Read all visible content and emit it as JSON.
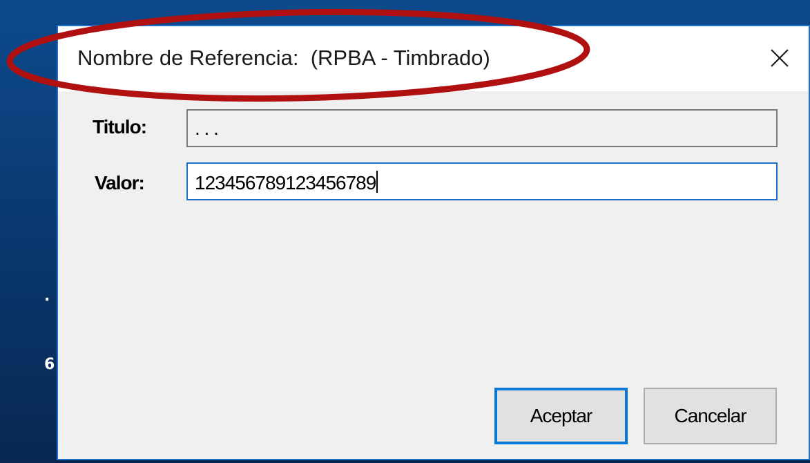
{
  "background": {
    "fragment_dot": ".",
    "fragment_partial": "6"
  },
  "dialog": {
    "title": "Nombre de Referencia:  (RPBA - Timbrado)",
    "close_icon": "close-icon",
    "fields": {
      "titulo_label": "Titulo:",
      "titulo_value": ". . .",
      "valor_label": "Valor:",
      "valor_value": "123456789123456789"
    },
    "buttons": {
      "accept_label": "Aceptar",
      "cancel_label": "Cancelar"
    }
  },
  "colors": {
    "annotation": "#b01010",
    "accent": "#1e6fc8"
  }
}
